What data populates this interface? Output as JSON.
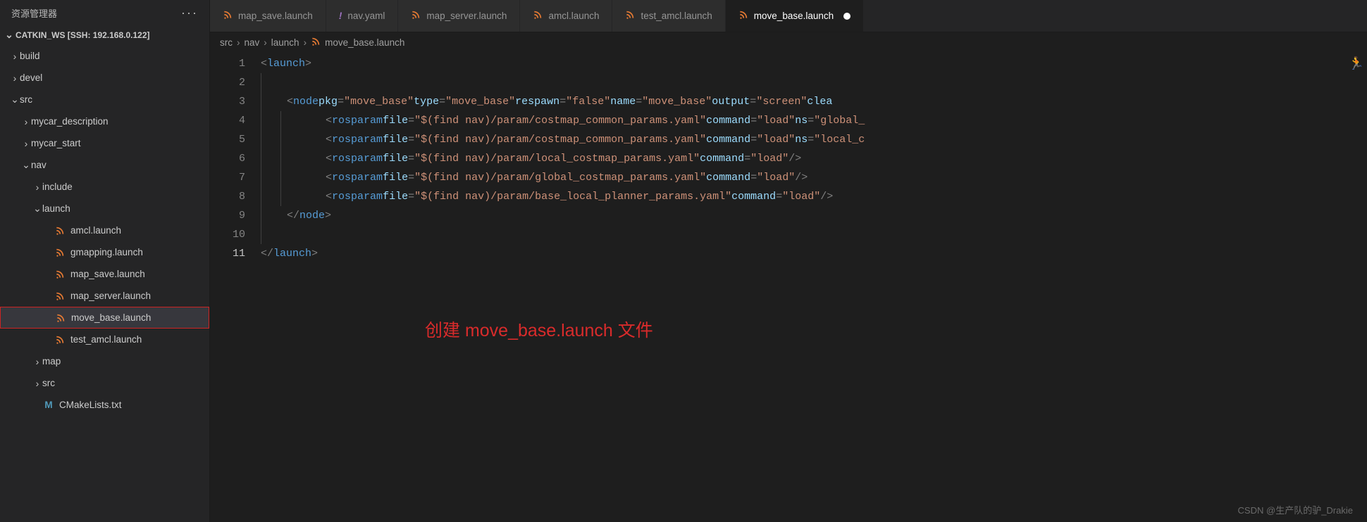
{
  "sidebar": {
    "title": "资源管理器",
    "workspace": "CATKIN_WS [SSH: 192.168.0.122]",
    "items": [
      {
        "label": "build",
        "type": "folder",
        "expanded": false,
        "depth": 0
      },
      {
        "label": "devel",
        "type": "folder",
        "expanded": false,
        "depth": 0
      },
      {
        "label": "src",
        "type": "folder",
        "expanded": true,
        "depth": 0
      },
      {
        "label": "mycar_description",
        "type": "folder",
        "expanded": false,
        "depth": 1
      },
      {
        "label": "mycar_start",
        "type": "folder",
        "expanded": false,
        "depth": 1
      },
      {
        "label": "nav",
        "type": "folder",
        "expanded": true,
        "depth": 1
      },
      {
        "label": "include",
        "type": "folder",
        "expanded": false,
        "depth": 2
      },
      {
        "label": "launch",
        "type": "folder",
        "expanded": true,
        "depth": 2
      },
      {
        "label": "amcl.launch",
        "type": "file",
        "icon": "rss",
        "depth": 3
      },
      {
        "label": "gmapping.launch",
        "type": "file",
        "icon": "rss",
        "depth": 3
      },
      {
        "label": "map_save.launch",
        "type": "file",
        "icon": "rss",
        "depth": 3
      },
      {
        "label": "map_server.launch",
        "type": "file",
        "icon": "rss",
        "depth": 3
      },
      {
        "label": "move_base.launch",
        "type": "file",
        "icon": "rss",
        "depth": 3,
        "selected": true,
        "highlighted": true
      },
      {
        "label": "test_amcl.launch",
        "type": "file",
        "icon": "rss",
        "depth": 3
      },
      {
        "label": "map",
        "type": "folder",
        "expanded": false,
        "depth": 2
      },
      {
        "label": "src",
        "type": "folder",
        "expanded": false,
        "depth": 2
      },
      {
        "label": "CMakeLists.txt",
        "type": "file",
        "icon": "m",
        "depth": 2
      }
    ]
  },
  "tabs": [
    {
      "label": "map_save.launch",
      "icon": "rss",
      "active": false
    },
    {
      "label": "nav.yaml",
      "icon": "excl",
      "active": false
    },
    {
      "label": "map_server.launch",
      "icon": "rss",
      "active": false
    },
    {
      "label": "amcl.launch",
      "icon": "rss",
      "active": false
    },
    {
      "label": "test_amcl.launch",
      "icon": "rss",
      "active": false
    },
    {
      "label": "move_base.launch",
      "icon": "rss",
      "active": true,
      "modified": true
    }
  ],
  "breadcrumbs": [
    "src",
    "nav",
    "launch",
    "move_base.launch"
  ],
  "code": {
    "1": "<launch>",
    "2": "",
    "3_tag": "node",
    "3_pkg": "move_base",
    "3_type": "move_base",
    "3_respawn": "false",
    "3_name": "move_base",
    "3_output": "screen",
    "4_tag": "rosparam",
    "4_file": "$(find nav)/param/costmap_common_params.yaml",
    "4_cmd": "load",
    "4_ns": "global_",
    "5_tag": "rosparam",
    "5_file": "$(find nav)/param/costmap_common_params.yaml",
    "5_cmd": "load",
    "5_ns": "local_c",
    "6_tag": "rosparam",
    "6_file": "$(find nav)/param/local_costmap_params.yaml",
    "6_cmd": "load",
    "7_tag": "rosparam",
    "7_file": "$(find nav)/param/global_costmap_params.yaml",
    "7_cmd": "load",
    "8_tag": "rosparam",
    "8_file": "$(find nav)/param/base_local_planner_params.yaml",
    "8_cmd": "load",
    "9": "</node>",
    "11": "</launch>",
    "attr_pkg": "pkg",
    "attr_type": "type",
    "attr_respawn": "respawn",
    "attr_name": "name",
    "attr_output": "output",
    "attr_clea": "clea",
    "attr_file": "file",
    "attr_command": "command",
    "attr_ns": "ns"
  },
  "annotation": "创建 move_base.launch 文件",
  "watermark": "CSDN @生产队的驴_Drakie"
}
